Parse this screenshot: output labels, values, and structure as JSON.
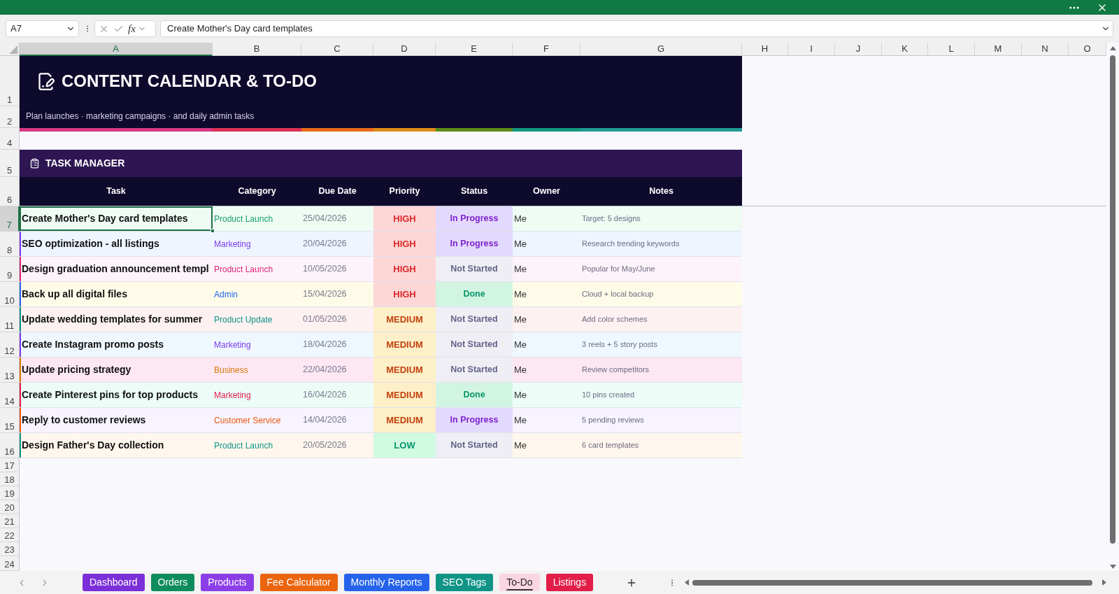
{
  "formula_bar": {
    "name_box": "A7",
    "function_label": "fx",
    "formula": "Create Mother's Day card templates"
  },
  "column_headers": [
    {
      "label": "A",
      "selected": true
    },
    {
      "label": "B",
      "selected": false
    },
    {
      "label": "C",
      "selected": false
    },
    {
      "label": "D",
      "selected": false
    },
    {
      "label": "E",
      "selected": false
    },
    {
      "label": "F",
      "selected": false
    },
    {
      "label": "G",
      "selected": false
    },
    {
      "label": "H",
      "selected": false
    },
    {
      "label": "I",
      "selected": false
    },
    {
      "label": "J",
      "selected": false
    },
    {
      "label": "K",
      "selected": false
    },
    {
      "label": "L",
      "selected": false
    },
    {
      "label": "M",
      "selected": false
    },
    {
      "label": "N",
      "selected": false
    },
    {
      "label": "O",
      "selected": false
    }
  ],
  "row_headers": [
    {
      "label": "1",
      "selected": false
    },
    {
      "label": "2",
      "selected": false
    },
    {
      "label": "4",
      "selected": false
    },
    {
      "label": "5",
      "selected": false
    },
    {
      "label": "6",
      "selected": false
    },
    {
      "label": "7",
      "selected": true
    },
    {
      "label": "8",
      "selected": false
    },
    {
      "label": "9",
      "selected": false
    },
    {
      "label": "10",
      "selected": false
    },
    {
      "label": "11",
      "selected": false
    },
    {
      "label": "12",
      "selected": false
    },
    {
      "label": "13",
      "selected": false
    },
    {
      "label": "14",
      "selected": false
    },
    {
      "label": "15",
      "selected": false
    },
    {
      "label": "16",
      "selected": false
    },
    {
      "label": "17",
      "selected": false
    },
    {
      "label": "18",
      "selected": false
    },
    {
      "label": "19",
      "selected": false
    },
    {
      "label": "20",
      "selected": false
    },
    {
      "label": "21",
      "selected": false
    },
    {
      "label": "22",
      "selected": false
    },
    {
      "label": "23",
      "selected": false
    },
    {
      "label": "24",
      "selected": false
    }
  ],
  "banner": {
    "title": "CONTENT CALENDAR & TO-DO",
    "subtitle": "Plan launches · marketing campaigns · and daily admin tasks"
  },
  "section": {
    "title": "TASK MANAGER"
  },
  "table": {
    "columns": [
      "Task",
      "Category",
      "Due Date",
      "Priority",
      "Status",
      "Owner",
      "Notes"
    ],
    "rows": [
      {
        "selected": true,
        "color": "#effcf4",
        "task": "Create Mother's Day card templates",
        "category": {
          "text": "Product Launch",
          "color": "#16a06e"
        },
        "due_date": "25/04/2026",
        "priority": {
          "text": "HIGH",
          "kind": "high"
        },
        "status": {
          "text": "In Progress",
          "kind": "in_progress"
        },
        "owner": "Me",
        "notes": "Target: 5 designs"
      },
      {
        "selected": false,
        "color": "#eef5ff",
        "task": "SEO optimization - all listings",
        "category": {
          "text": "Marketing",
          "color": "#7c3aed"
        },
        "due_date": "20/04/2026",
        "priority": {
          "text": "HIGH",
          "kind": "high"
        },
        "status": {
          "text": "In Progress",
          "kind": "in_progress"
        },
        "owner": "Me",
        "notes": "Research trending keywords"
      },
      {
        "selected": false,
        "color": "#fdf3fb",
        "task": "Design graduation announcement templ",
        "category": {
          "text": "Product Launch",
          "color": "#db2777"
        },
        "due_date": "10/05/2026",
        "priority": {
          "text": "HIGH",
          "kind": "high"
        },
        "status": {
          "text": "Not Started",
          "kind": "not_started"
        },
        "owner": "Me",
        "notes": "Popular for May/June"
      },
      {
        "selected": false,
        "color": "#fefce9",
        "task": "Back up all digital files",
        "category": {
          "text": "Admin",
          "color": "#2563eb"
        },
        "due_date": "15/04/2026",
        "priority": {
          "text": "HIGH",
          "kind": "high"
        },
        "status": {
          "text": "Done",
          "kind": "done"
        },
        "owner": "Me",
        "notes": "Cloud + local backup"
      },
      {
        "selected": false,
        "color": "#fef1f1",
        "task": "Update wedding templates for summer",
        "category": {
          "text": "Product Update",
          "color": "#0d9488"
        },
        "due_date": "01/05/2026",
        "priority": {
          "text": "MEDIUM",
          "kind": "medium"
        },
        "status": {
          "text": "Not Started",
          "kind": "not_started"
        },
        "owner": "Me",
        "notes": "Add color schemes"
      },
      {
        "selected": false,
        "color": "#eff8ff",
        "task": "Create Instagram promo posts",
        "category": {
          "text": "Marketing",
          "color": "#7c3aed"
        },
        "due_date": "18/04/2026",
        "priority": {
          "text": "MEDIUM",
          "kind": "medium"
        },
        "status": {
          "text": "Not Started",
          "kind": "not_started"
        },
        "owner": "Me",
        "notes": "3 reels + 5 story posts"
      },
      {
        "selected": false,
        "color": "#fce7f3",
        "task": "Update pricing strategy",
        "category": {
          "text": "Business",
          "color": "#d97706"
        },
        "due_date": "22/04/2026",
        "priority": {
          "text": "MEDIUM",
          "kind": "medium"
        },
        "status": {
          "text": "Not Started",
          "kind": "not_started"
        },
        "owner": "Me",
        "notes": "Review competitors"
      },
      {
        "selected": false,
        "color": "#ecfdf8",
        "task": "Create Pinterest pins for top products",
        "category": {
          "text": "Marketing",
          "color": "#e11d48"
        },
        "due_date": "16/04/2026",
        "priority": {
          "text": "MEDIUM",
          "kind": "medium"
        },
        "status": {
          "text": "Done",
          "kind": "done"
        },
        "owner": "Me",
        "notes": "10 pins created"
      },
      {
        "selected": false,
        "color": "#f7f3ff",
        "task": "Reply to customer reviews",
        "category": {
          "text": "Customer Service",
          "color": "#ea580c"
        },
        "due_date": "14/04/2026",
        "priority": {
          "text": "MEDIUM",
          "kind": "medium"
        },
        "status": {
          "text": "In Progress",
          "kind": "in_progress"
        },
        "owner": "Me",
        "notes": "5 pending reviews"
      },
      {
        "selected": false,
        "color": "#fff7ed",
        "task": "Design Father's Day collection",
        "category": {
          "text": "Product Launch",
          "color": "#0d9488"
        },
        "due_date": "20/05/2026",
        "priority": {
          "text": "LOW",
          "kind": "low"
        },
        "status": {
          "text": "Not Started",
          "kind": "not_started"
        },
        "owner": "Me",
        "notes": "6 card templates"
      }
    ]
  },
  "sheet_tabs": [
    {
      "label": "Dashboard",
      "color": "#7b2fd8",
      "selected": false
    },
    {
      "label": "Orders",
      "color": "#0f8c5e",
      "selected": false
    },
    {
      "label": "Products",
      "color": "#8b3ee8",
      "selected": false
    },
    {
      "label": "Fee Calculator",
      "color": "#ea650e",
      "selected": false
    },
    {
      "label": "Monthly Reports",
      "color": "#2563eb",
      "selected": false
    },
    {
      "label": "SEO Tags",
      "color": "#0f9486",
      "selected": false
    },
    {
      "label": "To-Do",
      "color": "#fad6e3",
      "selected": true
    },
    {
      "label": "Listings",
      "color": "#e11d48",
      "selected": false
    }
  ]
}
